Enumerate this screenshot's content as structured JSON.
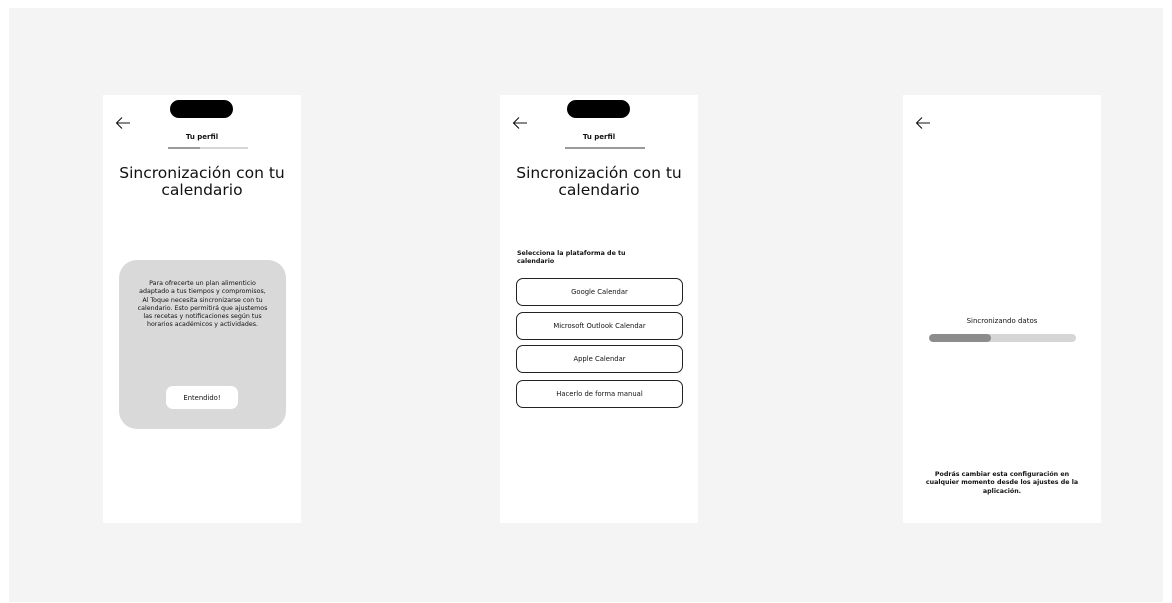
{
  "screens": [
    {
      "profile_label": "Tu perfil",
      "progress": 0.4,
      "title": "Sincronización con tu calendario",
      "info_text": "Para ofrecerte un plan alimenticio adaptado a tus tiempos y compromisos, Al Toque necesita sincronizarse con tu calendario. Esto permitirá que ajustemos las recetas y notificaciones según tus horarios académicos y actividades.",
      "button_label": "Entendido!"
    },
    {
      "profile_label": "Tu perfil",
      "progress": 1.0,
      "title": "Sincronización con tu calendario",
      "select_label": "Selecciona la plataforma de tu calendario",
      "options": [
        "Google Calendar",
        "Microsoft Outlook Calendar",
        "Apple Calendar",
        "Hacerlo de forma manual"
      ]
    },
    {
      "sync_label": "Sincronizando datos",
      "sync_progress": 0.42,
      "footnote": "Podrás cambiar esta configuración en cualquier momento desde los ajustes de la aplicación."
    }
  ],
  "icons": {
    "back": "arrow-left-icon"
  },
  "colors": {
    "canvas": "#f4f4f4",
    "card": "#d9d9d9",
    "notch": "#000000",
    "progress_fill": "#9a9a9a"
  }
}
